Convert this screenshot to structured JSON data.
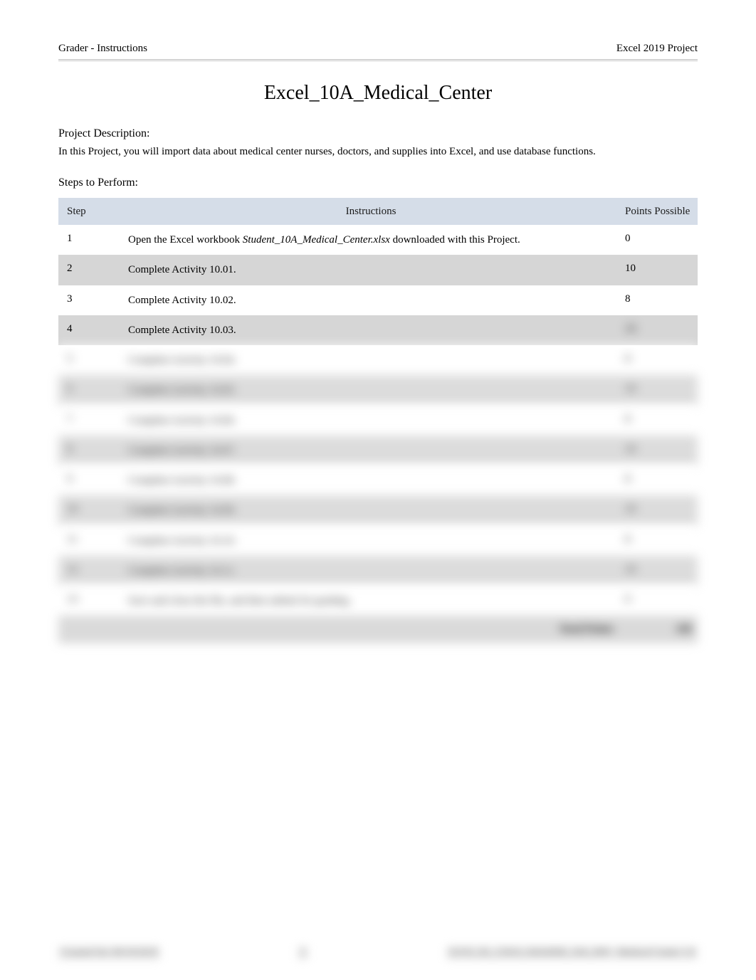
{
  "header": {
    "left": "Grader - Instructions",
    "right": "Excel 2019 Project"
  },
  "title": "Excel_10A_Medical_Center",
  "description": {
    "label": "Project Description:",
    "text": "In this Project, you will import data about medical center nurses, doctors, and supplies into Excel, and use database functions."
  },
  "steps_label": "Steps to Perform:",
  "table_header": {
    "step": "Step",
    "instructions": "Instructions",
    "points": "Points Possible"
  },
  "rows": [
    {
      "step": "1",
      "instr_pre": "Open the Excel workbook ",
      "instr_file": "Student_10A_Medical_Center.xlsx",
      "instr_post": " downloaded with this Project.",
      "points": "0"
    },
    {
      "step": "2",
      "instr": "Complete Activity 10.01.",
      "points": "10"
    },
    {
      "step": "3",
      "instr": "Complete Activity 10.02.",
      "points": "8"
    },
    {
      "step": "4",
      "instr": "Complete Activity 10.03.",
      "points": "10"
    },
    {
      "step": "5",
      "instr": "Complete Activity 10.04.",
      "points": "8"
    },
    {
      "step": "6",
      "instr": "Complete Activity 10.05.",
      "points": "10"
    },
    {
      "step": "7",
      "instr": "Complete Activity 10.06.",
      "points": "8"
    },
    {
      "step": "8",
      "instr": "Complete Activity 10.07.",
      "points": "10"
    },
    {
      "step": "9",
      "instr": "Complete Activity 10.08.",
      "points": "8"
    },
    {
      "step": "10",
      "instr": "Complete Activity 10.09.",
      "points": "10"
    },
    {
      "step": "11",
      "instr": "Complete Activity 10.10.",
      "points": "8"
    },
    {
      "step": "12",
      "instr": "Complete Activity 10.11.",
      "points": "10"
    },
    {
      "step": "13",
      "instr": "Save and close the file, and then submit for grading.",
      "points": "0"
    }
  ],
  "total": {
    "label": "Total Points",
    "value": "100"
  },
  "footer": {
    "left": "Created On: 09/19/2019",
    "center": "1",
    "right": "GO19_XL_CH10_GRADER_10A_HW - Medical Center 1.0"
  }
}
